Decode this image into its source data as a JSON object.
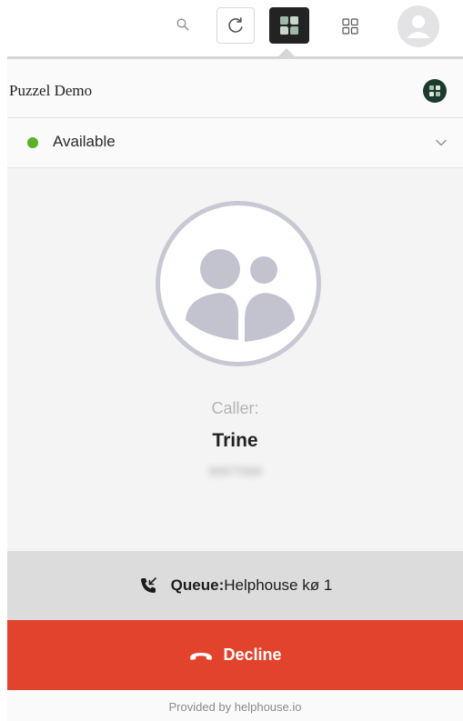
{
  "toolbar": {
    "icons": [
      "search-icon",
      "refresh-icon",
      "puzzel-extension-icon",
      "apps-grid-icon",
      "user-avatar-icon"
    ]
  },
  "header": {
    "title": "Puzzel Demo",
    "logo_icon": "puzzel-logo-icon"
  },
  "status": {
    "label": "Available",
    "color": "#5bb02a"
  },
  "call": {
    "caller_title": "Caller:",
    "caller_name": "Trine",
    "caller_number": "55577000"
  },
  "queue": {
    "key": "Queue:",
    "name": "Helphouse kø 1"
  },
  "decline": {
    "label": "Decline",
    "color": "#e2432c"
  },
  "footer": {
    "text": "Provided by helphouse.io"
  }
}
